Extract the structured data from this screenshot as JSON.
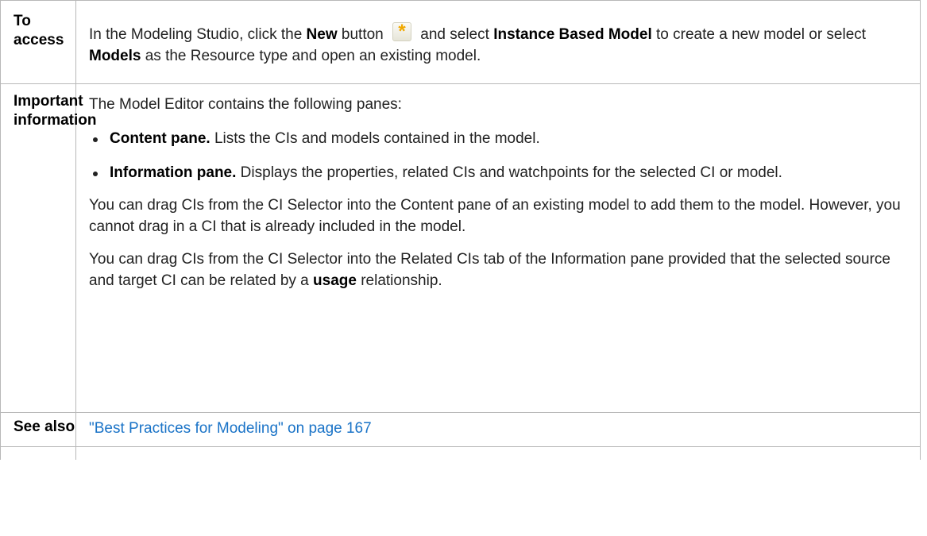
{
  "rows": {
    "access": {
      "label": "To access",
      "t1": "In the Modeling Studio, click the ",
      "b1": "New",
      "t2": " button ",
      "icon": "new-asterisk-icon",
      "t3": " and select ",
      "b2": "Instance Based Model",
      "t4": " to create a new model or select ",
      "b3": "Models",
      "t5": " as the Resource type and open an existing model."
    },
    "important": {
      "label": "Important information",
      "intro": "The Model Editor contains the following panes:",
      "bullets": [
        {
          "bold": "Content pane.",
          "text": " Lists the CIs and models contained in the model."
        },
        {
          "bold": "Information pane.",
          "text": " Displays the properties, related CIs and watchpoints for the selected CI or model."
        }
      ],
      "para1": "You can drag CIs from the CI Selector into the Content pane of an existing model to add them to the model. However, you cannot drag in a CI that is already included in the model.",
      "para2_a": "You can drag CIs from the CI Selector into the Related CIs tab of the Information pane provided that the selected source and target CI can be related by a ",
      "para2_b": "usage",
      "para2_c": " relationship."
    },
    "see_also": {
      "label": "See also",
      "link": "\"Best Practices for Modeling\" on page 167"
    }
  },
  "colors": {
    "link": "#1a73c7",
    "border": "#b8b8b8",
    "icon": "#f0a800"
  }
}
